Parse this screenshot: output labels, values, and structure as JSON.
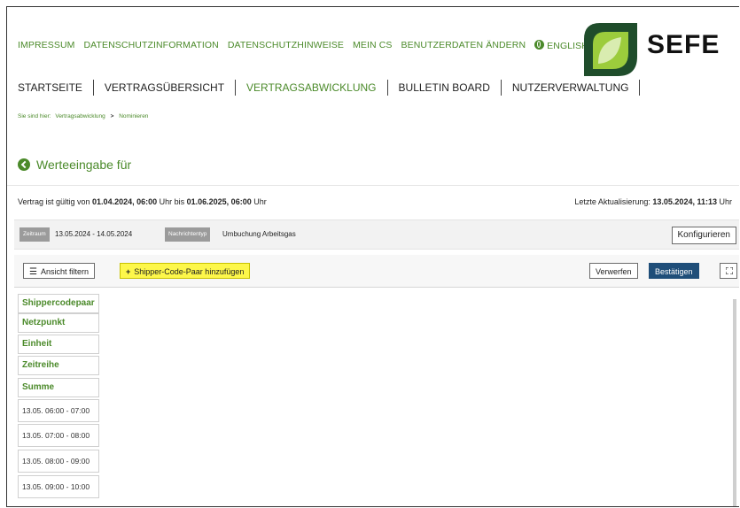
{
  "toplinks": {
    "impressum": "IMPRESSUM",
    "datenschutzinformation": "DATENSCHUTZINFORMATION",
    "datenschutzhinweise": "DATENSCHUTZHINWEISE",
    "mein_cs": "MEIN CS",
    "benutzerdaten": "BENUTZERDATEN ÄNDERN",
    "english": "ENGLISH"
  },
  "logo": {
    "text": "SEFE",
    "colors": {
      "dark": "#1f4d2b",
      "light": "#9ccc3c"
    }
  },
  "nav": {
    "items": [
      "STARTSEITE",
      "VERTRAGSÜBERSICHT",
      "VERTRAGSABWICKLUNG",
      "BULLETIN BOARD",
      "NUTZERVERWALTUNG"
    ],
    "active_index": 2
  },
  "breadcrumb": {
    "prefix": "Sie sind hier:",
    "level1": "Vertragsabwicklung",
    "separator": ">",
    "level2": "Nominieren"
  },
  "page": {
    "title": "Werteeingabe für"
  },
  "validity": {
    "prefix": "Vertrag ist gültig von ",
    "from": "01.04.2024, 06:00",
    "mid": " Uhr bis ",
    "to": "01.06.2025, 06:00",
    "suffix": " Uhr"
  },
  "updated": {
    "prefix": "Letzte Aktualisierung: ",
    "value": "13.05.2024, 11:13",
    "suffix": " Uhr"
  },
  "filters": {
    "zeitraum_label": "Zeitraum",
    "zeitraum_value": "13.05.2024 - 14.05.2024",
    "nachrichtentyp_label": "Nachrichtentyp",
    "nachrichtentyp_value": "Umbuchung Arbeitsgas",
    "konfigurieren": "Konfigurieren"
  },
  "toolbar": {
    "ansicht_filtern": "Ansicht filtern",
    "add_pair": "Shipper-Code-Paar hinzufügen",
    "verwerfen": "Verwerfen",
    "bestaetigen": "Bestätigen"
  },
  "grid": {
    "headers": [
      "Shippercodepaar",
      "Netzpunkt",
      "Einheit",
      "Zeitreihe",
      "Summe"
    ],
    "times": [
      "13.05. 06:00 - 07:00",
      "13.05. 07:00 - 08:00",
      "13.05. 08:00 - 09:00",
      "13.05. 09:00 - 10:00"
    ]
  },
  "colors": {
    "accent": "#4b8a2a",
    "primary_button": "#1f4e79",
    "highlight": "#fdf74a"
  }
}
